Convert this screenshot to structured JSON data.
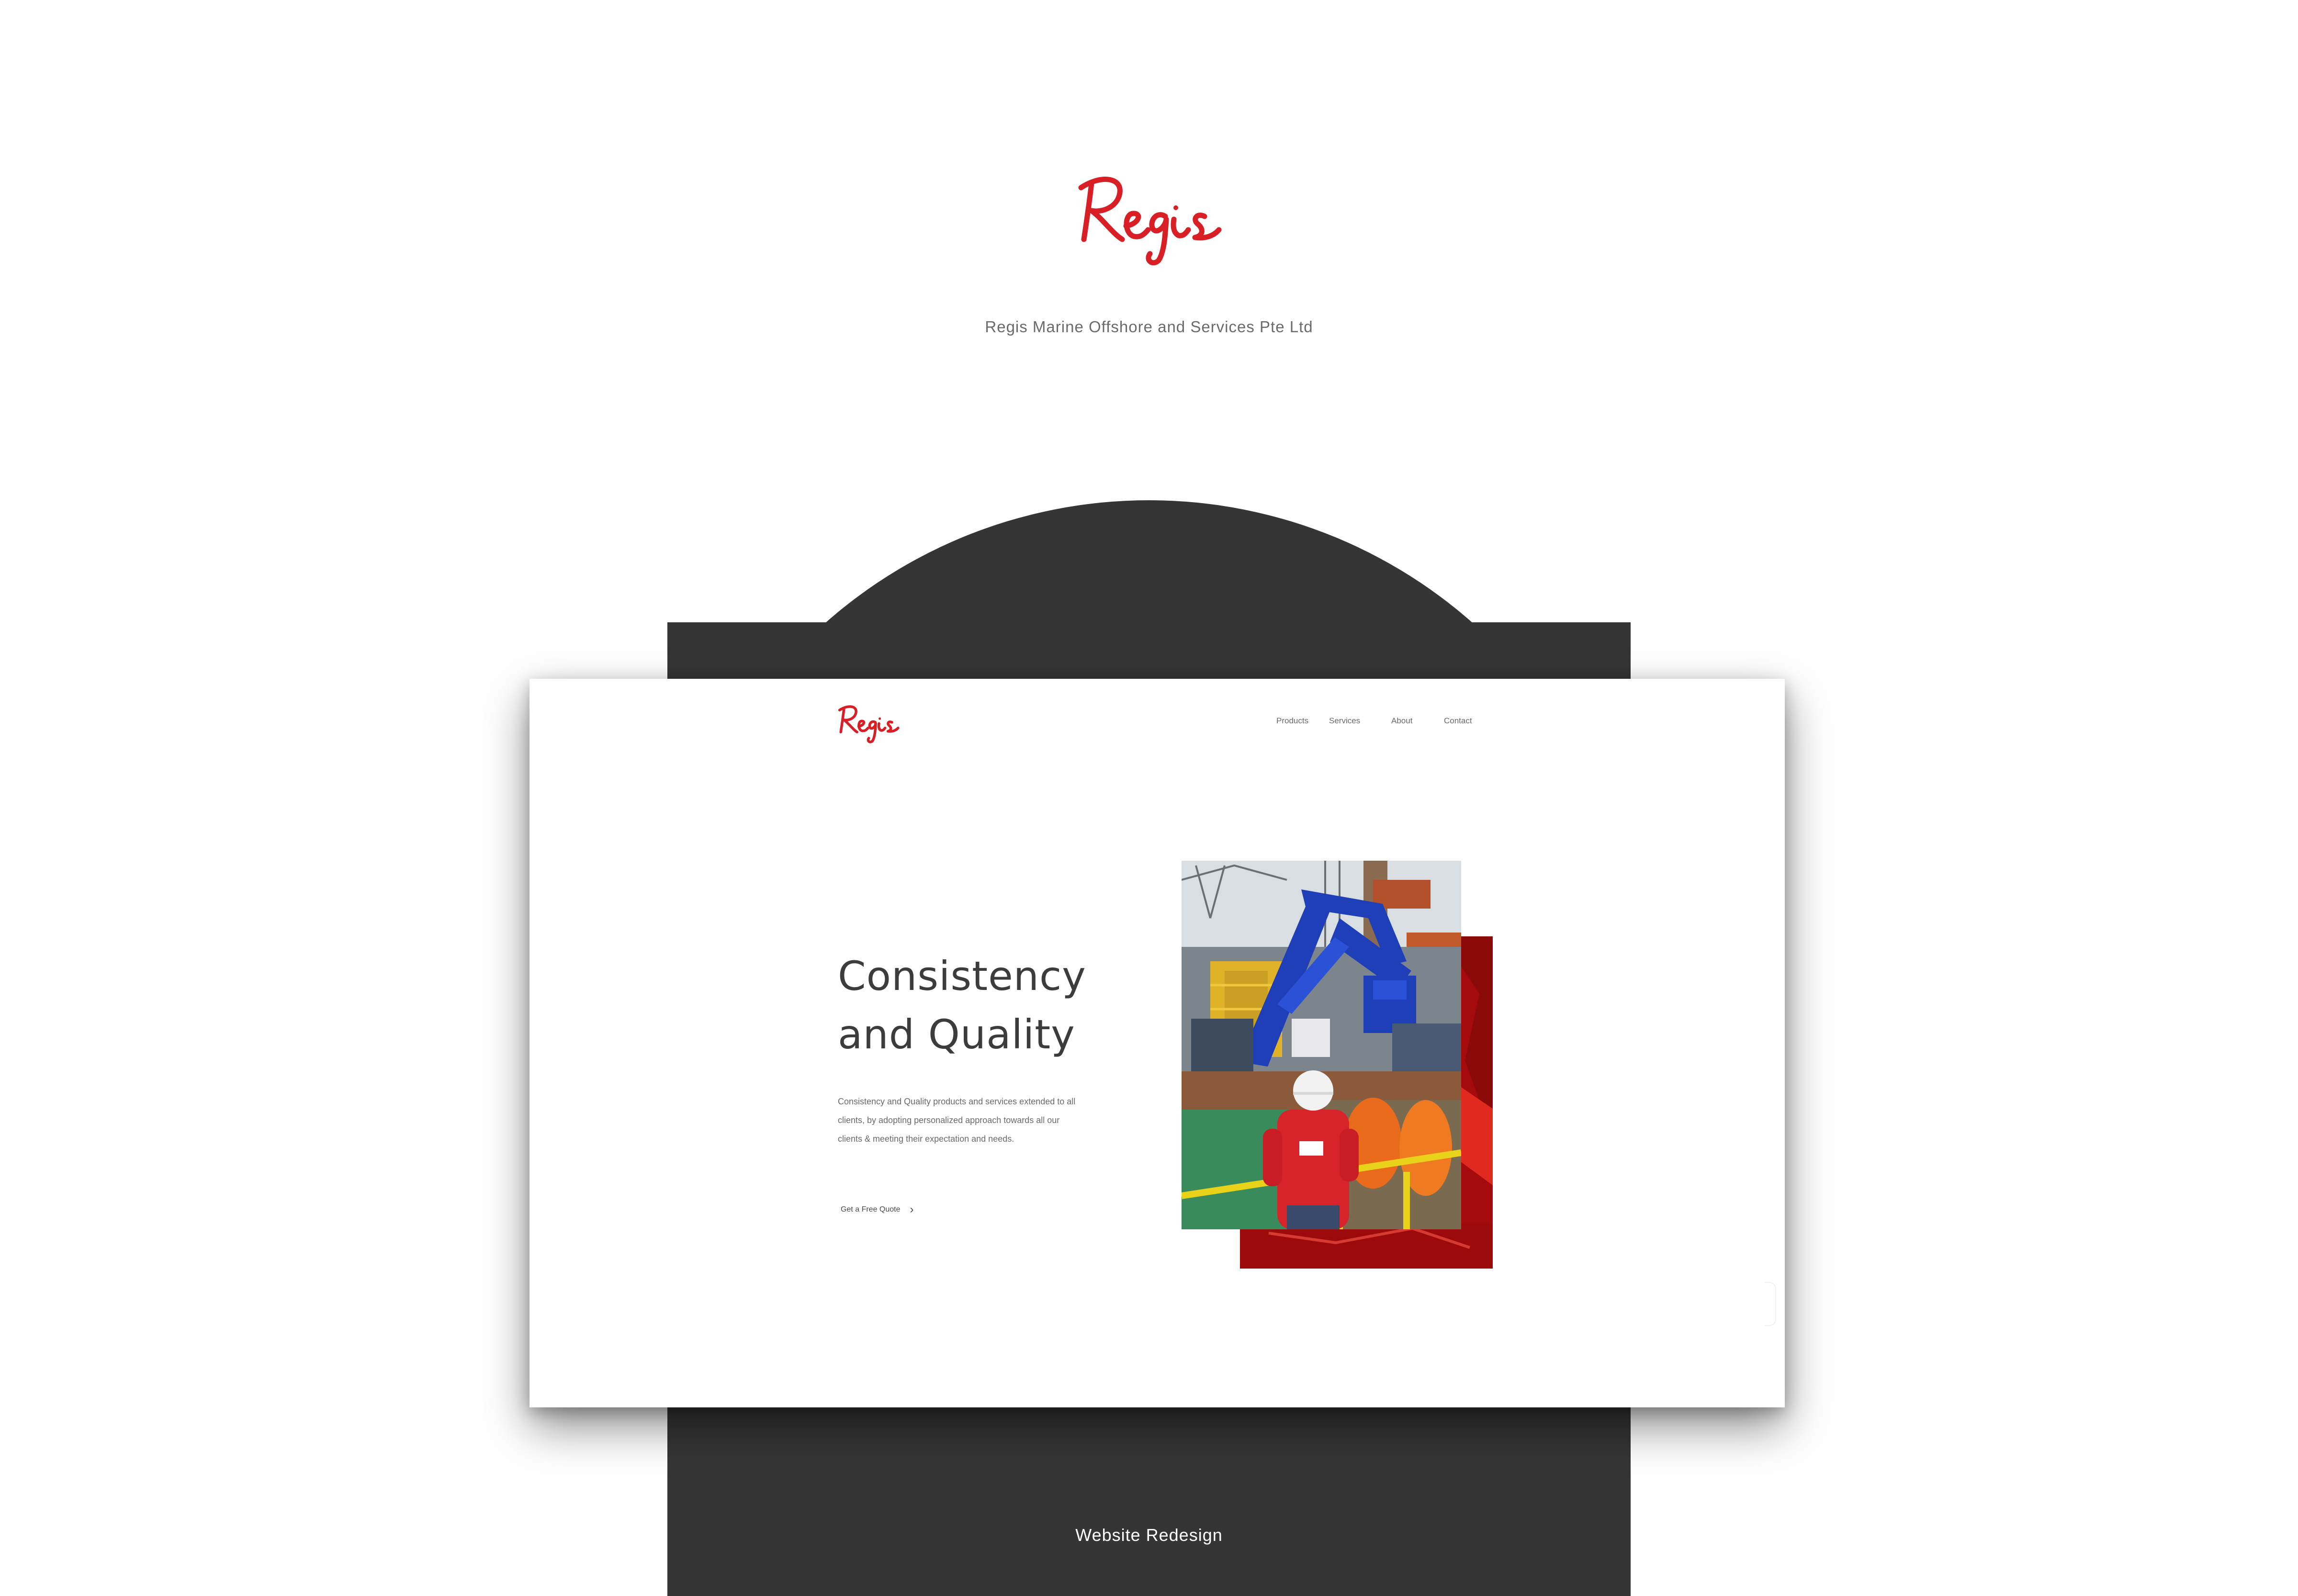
{
  "brand": {
    "logo_text": "Regis",
    "company_name": "Regis Marine Offshore and Services Pte Ltd",
    "accent_color": "#d81f26"
  },
  "mockup": {
    "logo_text": "Regis",
    "nav": [
      {
        "label": "Products"
      },
      {
        "label": "Services"
      },
      {
        "label": "About"
      },
      {
        "label": "Contact"
      }
    ],
    "hero": {
      "headline_line1": "Consistency",
      "headline_line2": "and Quality",
      "body": "Consistency and Quality products and services extended to all clients, by adopting personalized approach towards all our clients & meeting their expectation and needs.",
      "cta_label": "Get a Free Quote",
      "cta_icon": "chevron-right-icon"
    }
  },
  "footer": {
    "caption": "Website Redesign"
  },
  "colors": {
    "dark_backdrop": "#353535",
    "hero_red": "#c40f10"
  }
}
